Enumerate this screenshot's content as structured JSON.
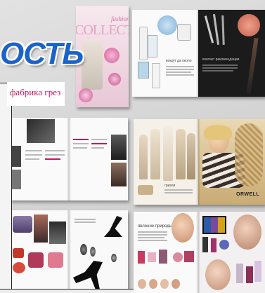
{
  "logo": {
    "text": "ОСТЬ"
  },
  "caption": {
    "text": "фабрика грез"
  },
  "magazine": {
    "title": "COLLECTION",
    "fashion_word": "fashion"
  },
  "spreads": {
    "beauty": {
      "left_heading": "вокруг да около",
      "right_heading": "контакт рекомендации"
    },
    "fashion": {
      "heading": "гризли",
      "brand": "ORWELL"
    },
    "makeup": {
      "heading": "явление природы"
    }
  },
  "colors": {
    "logo_blue": "#1a63c9",
    "caption_pink": "#c2185b",
    "background": "#d8d8d8"
  }
}
